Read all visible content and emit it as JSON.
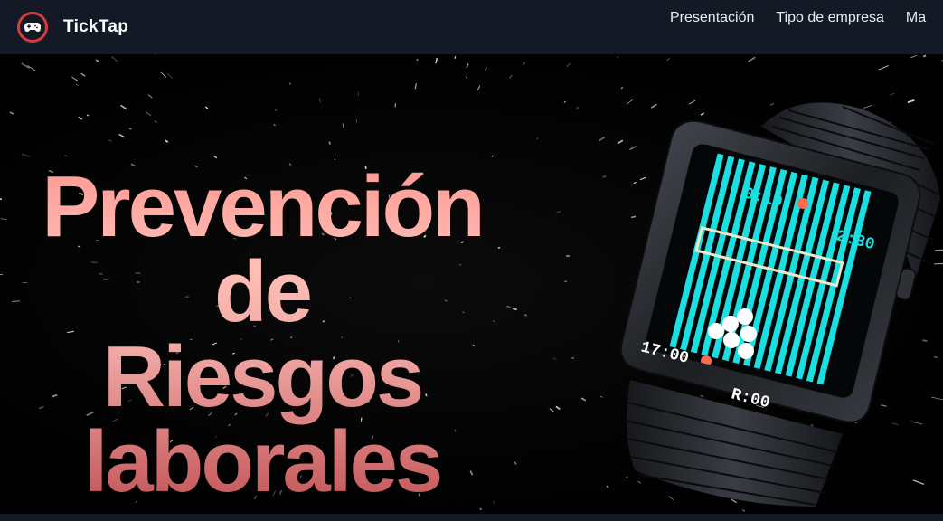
{
  "brand": {
    "name": "TickTap",
    "logo_icon": "gamepad-icon",
    "logo_color": "#d83b3b"
  },
  "nav": {
    "items": [
      {
        "label": "Presentación"
      },
      {
        "label": "Tipo de empresa"
      },
      {
        "label": "Ma"
      }
    ]
  },
  "hero": {
    "headline_lines": [
      "Prevención de",
      "Riesgos",
      "laborales"
    ],
    "watch": {
      "image": "smartwatch-game-image",
      "time_top_left": "0:10",
      "time_top_right": "2:30",
      "time_bottom_left": "17:00",
      "time_bottom_right": "R:00",
      "screen_color": "#19dfe0"
    }
  },
  "colors": {
    "navbar_bg": "#131a26",
    "headline_top": "#ff9a94",
    "headline_bottom": "#c4575a"
  }
}
